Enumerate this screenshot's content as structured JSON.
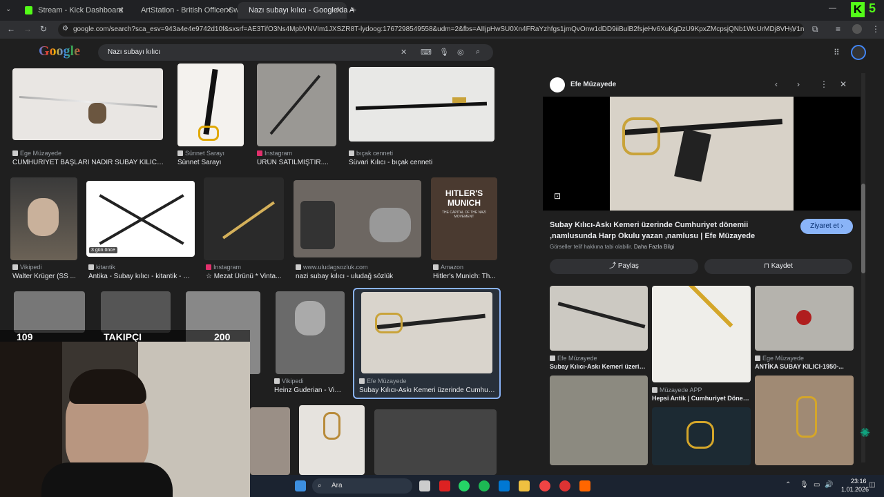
{
  "tabs": [
    {
      "label": "Stream - Kick Dashboard",
      "color": "#53fc18"
    },
    {
      "label": "ArtStation - British Officer Swor",
      "color": "#13aff0"
    },
    {
      "label": "Nazı subayı kılıcı - Google'da A",
      "color": "#e8eaed"
    }
  ],
  "url": "google.com/search?sca_esv=943a4e4e9742d10f&sxsrf=AE3TifO3Ns4MpbVNVIm1JXSZR8T-lydoog:1767298549558&udm=2&fbs=AIIjpHwSU0Xn4FRaYzhfgs1jmQvOnw1dDD9iiBulB2fsjeHv6XuKgDzU9KpxZMcpsjQNb1WcUrMDj8VH-V1nllcqw593jWT8...",
  "google": {
    "logo": "Google",
    "query": "Nazı subayı kılıcı"
  },
  "results": [
    {
      "src": "Ege Müzayede",
      "cap": "CUMHURİYET BAŞLARI NADİR SUBAY KILICI-..."
    },
    {
      "src": "Sünnet Sarayı",
      "cap": "Sünnet Sarayı"
    },
    {
      "src": "Instagram",
      "cap": "ÜRÜN SATILMIŞTIR...."
    },
    {
      "src": "bıçak cenneti",
      "cap": "Süvari Kılıcı - bıçak cenneti"
    },
    {
      "src": "Vikipedi",
      "cap": "Walter Krüger (SS ..."
    },
    {
      "src": "kitantik",
      "cap": "Antika - Subay kılıcı - kitantik - ki..."
    },
    {
      "src": "Instagram",
      "cap": "☆ Mezat Ürünü * Vinta..."
    },
    {
      "src": "www.uludagsozluk.com",
      "cap": "nazi subay kılıcı - uludağ sözlük"
    },
    {
      "src": "Amazon",
      "cap": "Hitler's Munich: Th..."
    },
    {
      "src": "Vikipedi",
      "cap": "Heinz Guderian - Viki..."
    },
    {
      "src": "Efe Müzayede",
      "cap": "Subay Kılıcı-Askı Kemeri üzerinde Cumhuri..."
    }
  ],
  "badge": "3 gün önce",
  "book": {
    "title": "HITLER'S MUNICH",
    "subtitle": "THE CAPITAL OF THE NAZI MOVEMENT"
  },
  "panel": {
    "source": "Efe Müzayede",
    "title": "Subay Kılıcı-Askı Kemeri üzerinde Cumhuriyet dönemii ,namlusunda Harp Okulu yazan ,namlusu | Efe Müzayede",
    "visit": "Ziyaret et",
    "copyright": "Görseller telif hakkına tabi olabilir.",
    "more": "Daha Fazla Bilgi",
    "share": "Paylaş",
    "save": "Kaydet",
    "related": [
      {
        "src": "Efe Müzayede",
        "cap": "Subay Kılıcı-Askı Kemeri üzerinde..."
      },
      {
        "src": "Müzayede APP",
        "cap": "Hepsi Antik | Cumhuriyet Dönemi..."
      },
      {
        "src": "Ege Müzayede",
        "cap": "ANTİKA SUBAY KILICI-1950-..."
      }
    ]
  },
  "stream": {
    "stat1": "109",
    "stat2": "TAKIPÇI",
    "stat3": "200"
  },
  "taskbar": {
    "search": "Ara",
    "time": "23:16",
    "date": "1.01.2026"
  },
  "colors": {
    "kick": "#53fc18",
    "visit": "#8ab4f8"
  }
}
